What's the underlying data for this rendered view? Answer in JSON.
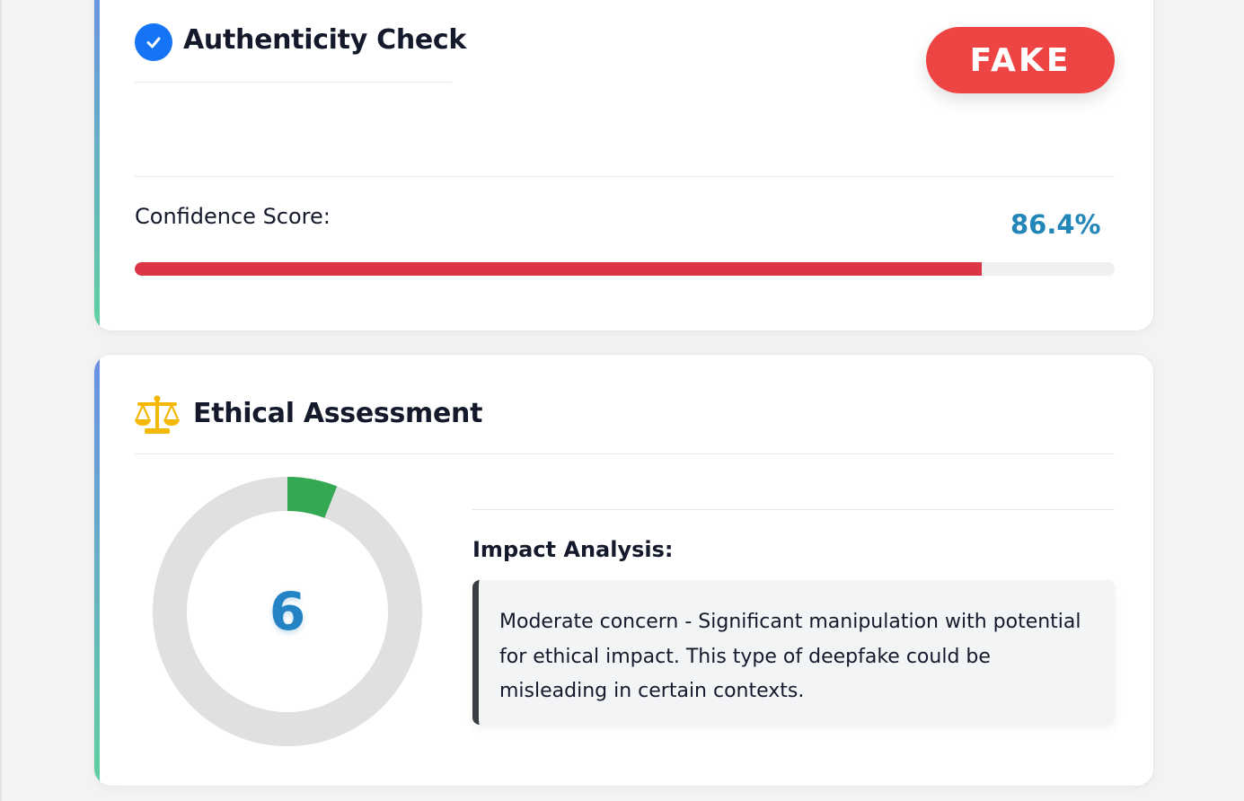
{
  "authenticity": {
    "title": "Authenticity Check",
    "verdict": "FAKE",
    "confidence_label": "Confidence Score:",
    "confidence_value": "86.4%",
    "confidence_fraction": 0.864,
    "bar_color": "#dc3545",
    "badge_color": "#ef4444"
  },
  "ethics": {
    "title": "Ethical Assessment",
    "score": "6",
    "score_fraction": 0.06,
    "gauge_color": "#34a853",
    "gauge_track_color": "#e0e0e0",
    "impact_heading": "Impact Analysis:",
    "impact_text": "Moderate concern - Significant manipulation with potential for ethical impact. This type of deepfake could be misleading in certain contexts."
  },
  "icons": {
    "auth_icon": "check-circle-icon",
    "ethics_icon": "balance-scale-icon"
  }
}
